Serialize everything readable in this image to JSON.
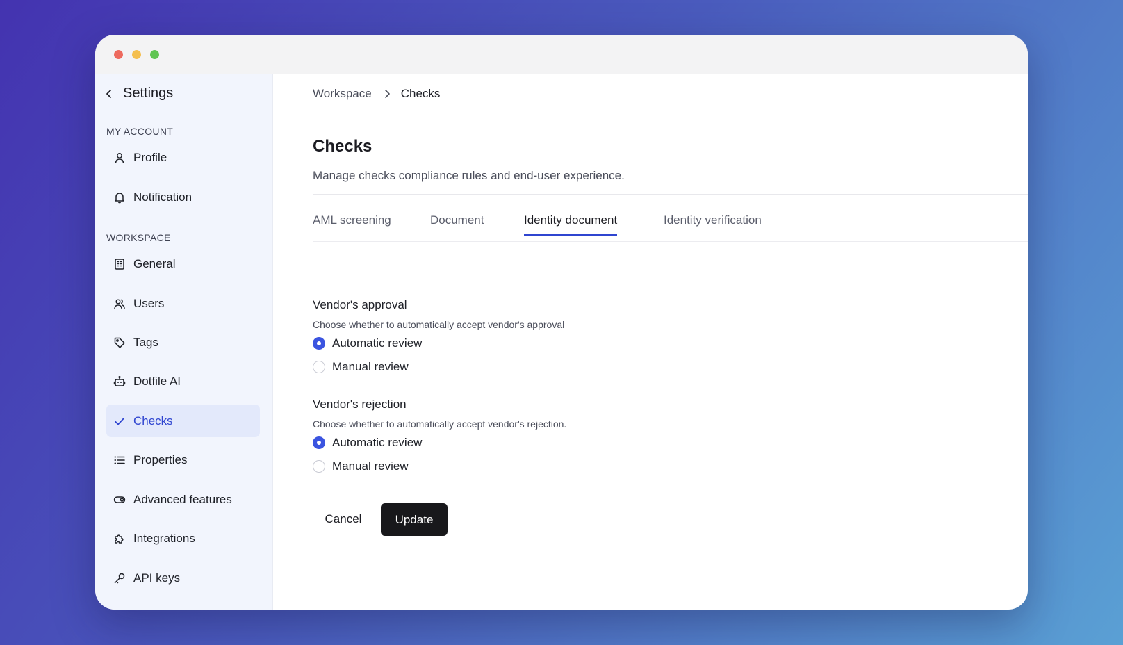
{
  "sidebar": {
    "title": "Settings",
    "sections": {
      "my_account": "MY ACCOUNT",
      "workspace": "WORKSPACE"
    },
    "items": {
      "profile": "Profile",
      "notification": "Notification",
      "general": "General",
      "users": "Users",
      "tags": "Tags",
      "dotfile_ai": "Dotfile AI",
      "checks": "Checks",
      "properties": "Properties",
      "advanced_features": "Advanced features",
      "integrations": "Integrations",
      "api_keys": "API keys"
    },
    "active_item": "checks"
  },
  "breadcrumb": [
    "Workspace",
    "Checks"
  ],
  "page": {
    "title": "Checks",
    "subtitle": "Manage checks compliance rules and end-user experience."
  },
  "tabs": [
    "AML screening",
    "Document",
    "Identity document",
    "Identity verification"
  ],
  "active_tab": "Identity document",
  "groups": [
    {
      "title": "Vendor's approval",
      "description": "Choose whether to automatically accept vendor's approval",
      "options": [
        "Automatic review",
        "Manual review"
      ],
      "selected": "Automatic review"
    },
    {
      "title": "Vendor's rejection",
      "description": "Choose whether to automatically accept vendor's rejection.",
      "options": [
        "Automatic review",
        "Manual review"
      ],
      "selected": "Automatic review"
    }
  ],
  "actions": {
    "cancel": "Cancel",
    "update": "Update"
  },
  "colors": {
    "accent": "#3b54e0",
    "active_nav_bg": "#e3e9fb",
    "primary_button": "#18181b",
    "sidebar_bg": "#f2f5fd"
  }
}
